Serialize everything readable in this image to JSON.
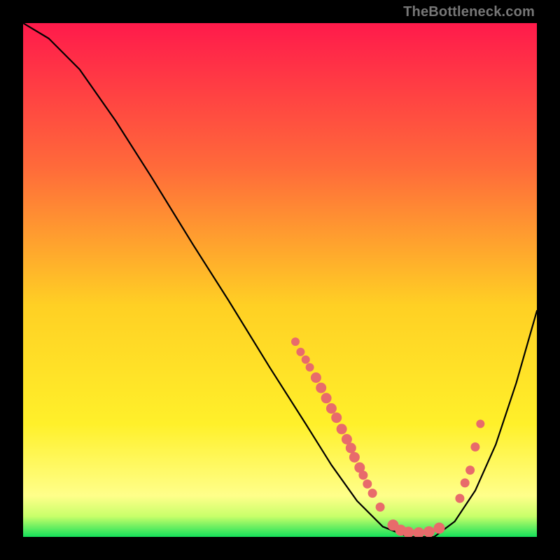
{
  "attribution": "TheBottleneck.com",
  "colors": {
    "gradient_top": "#ff1a4b",
    "gradient_mid_upper": "#ff6a3a",
    "gradient_mid": "#ffd024",
    "gradient_mid_lower": "#fff02a",
    "gradient_bottom_yellow": "#ffff8a",
    "gradient_green": "#14e05a",
    "curve": "#000000",
    "dot": "#e86b6b"
  },
  "chart_data": {
    "type": "line",
    "title": "",
    "xlabel": "",
    "ylabel": "",
    "xlim": [
      0,
      100
    ],
    "ylim": [
      0,
      100
    ],
    "curve": [
      {
        "x": 0,
        "y": 100
      },
      {
        "x": 5,
        "y": 97
      },
      {
        "x": 11,
        "y": 91
      },
      {
        "x": 18,
        "y": 81
      },
      {
        "x": 25,
        "y": 70
      },
      {
        "x": 33,
        "y": 57
      },
      {
        "x": 40,
        "y": 46
      },
      {
        "x": 48,
        "y": 33
      },
      {
        "x": 55,
        "y": 22
      },
      {
        "x": 60,
        "y": 14
      },
      {
        "x": 65,
        "y": 7
      },
      {
        "x": 70,
        "y": 2
      },
      {
        "x": 75,
        "y": 0
      },
      {
        "x": 80,
        "y": 0
      },
      {
        "x": 84,
        "y": 3
      },
      {
        "x": 88,
        "y": 9
      },
      {
        "x": 92,
        "y": 18
      },
      {
        "x": 96,
        "y": 30
      },
      {
        "x": 100,
        "y": 44
      }
    ],
    "dots": [
      {
        "x": 53,
        "y": 38,
        "r": 1.2
      },
      {
        "x": 54,
        "y": 36,
        "r": 1.2
      },
      {
        "x": 55,
        "y": 34.5,
        "r": 1.2
      },
      {
        "x": 55.8,
        "y": 33,
        "r": 1.2
      },
      {
        "x": 57,
        "y": 31,
        "r": 1.5
      },
      {
        "x": 58,
        "y": 29,
        "r": 1.5
      },
      {
        "x": 59,
        "y": 27,
        "r": 1.5
      },
      {
        "x": 60,
        "y": 25,
        "r": 1.5
      },
      {
        "x": 61,
        "y": 23.2,
        "r": 1.5
      },
      {
        "x": 62,
        "y": 21,
        "r": 1.5
      },
      {
        "x": 63,
        "y": 19,
        "r": 1.5
      },
      {
        "x": 63.8,
        "y": 17.3,
        "r": 1.5
      },
      {
        "x": 64.5,
        "y": 15.5,
        "r": 1.5
      },
      {
        "x": 65.5,
        "y": 13.5,
        "r": 1.5
      },
      {
        "x": 66.2,
        "y": 12,
        "r": 1.3
      },
      {
        "x": 67,
        "y": 10.3,
        "r": 1.3
      },
      {
        "x": 68,
        "y": 8.5,
        "r": 1.3
      },
      {
        "x": 69.5,
        "y": 5.8,
        "r": 1.3
      },
      {
        "x": 72,
        "y": 2.3,
        "r": 1.6
      },
      {
        "x": 73.5,
        "y": 1.3,
        "r": 1.6
      },
      {
        "x": 75,
        "y": 0.9,
        "r": 1.6
      },
      {
        "x": 77,
        "y": 0.8,
        "r": 1.6
      },
      {
        "x": 79,
        "y": 1.0,
        "r": 1.6
      },
      {
        "x": 81,
        "y": 1.7,
        "r": 1.6
      },
      {
        "x": 85,
        "y": 7.5,
        "r": 1.3
      },
      {
        "x": 86,
        "y": 10.5,
        "r": 1.3
      },
      {
        "x": 87,
        "y": 13,
        "r": 1.3
      },
      {
        "x": 88,
        "y": 17.5,
        "r": 1.3
      },
      {
        "x": 89,
        "y": 22,
        "r": 1.2
      }
    ]
  }
}
